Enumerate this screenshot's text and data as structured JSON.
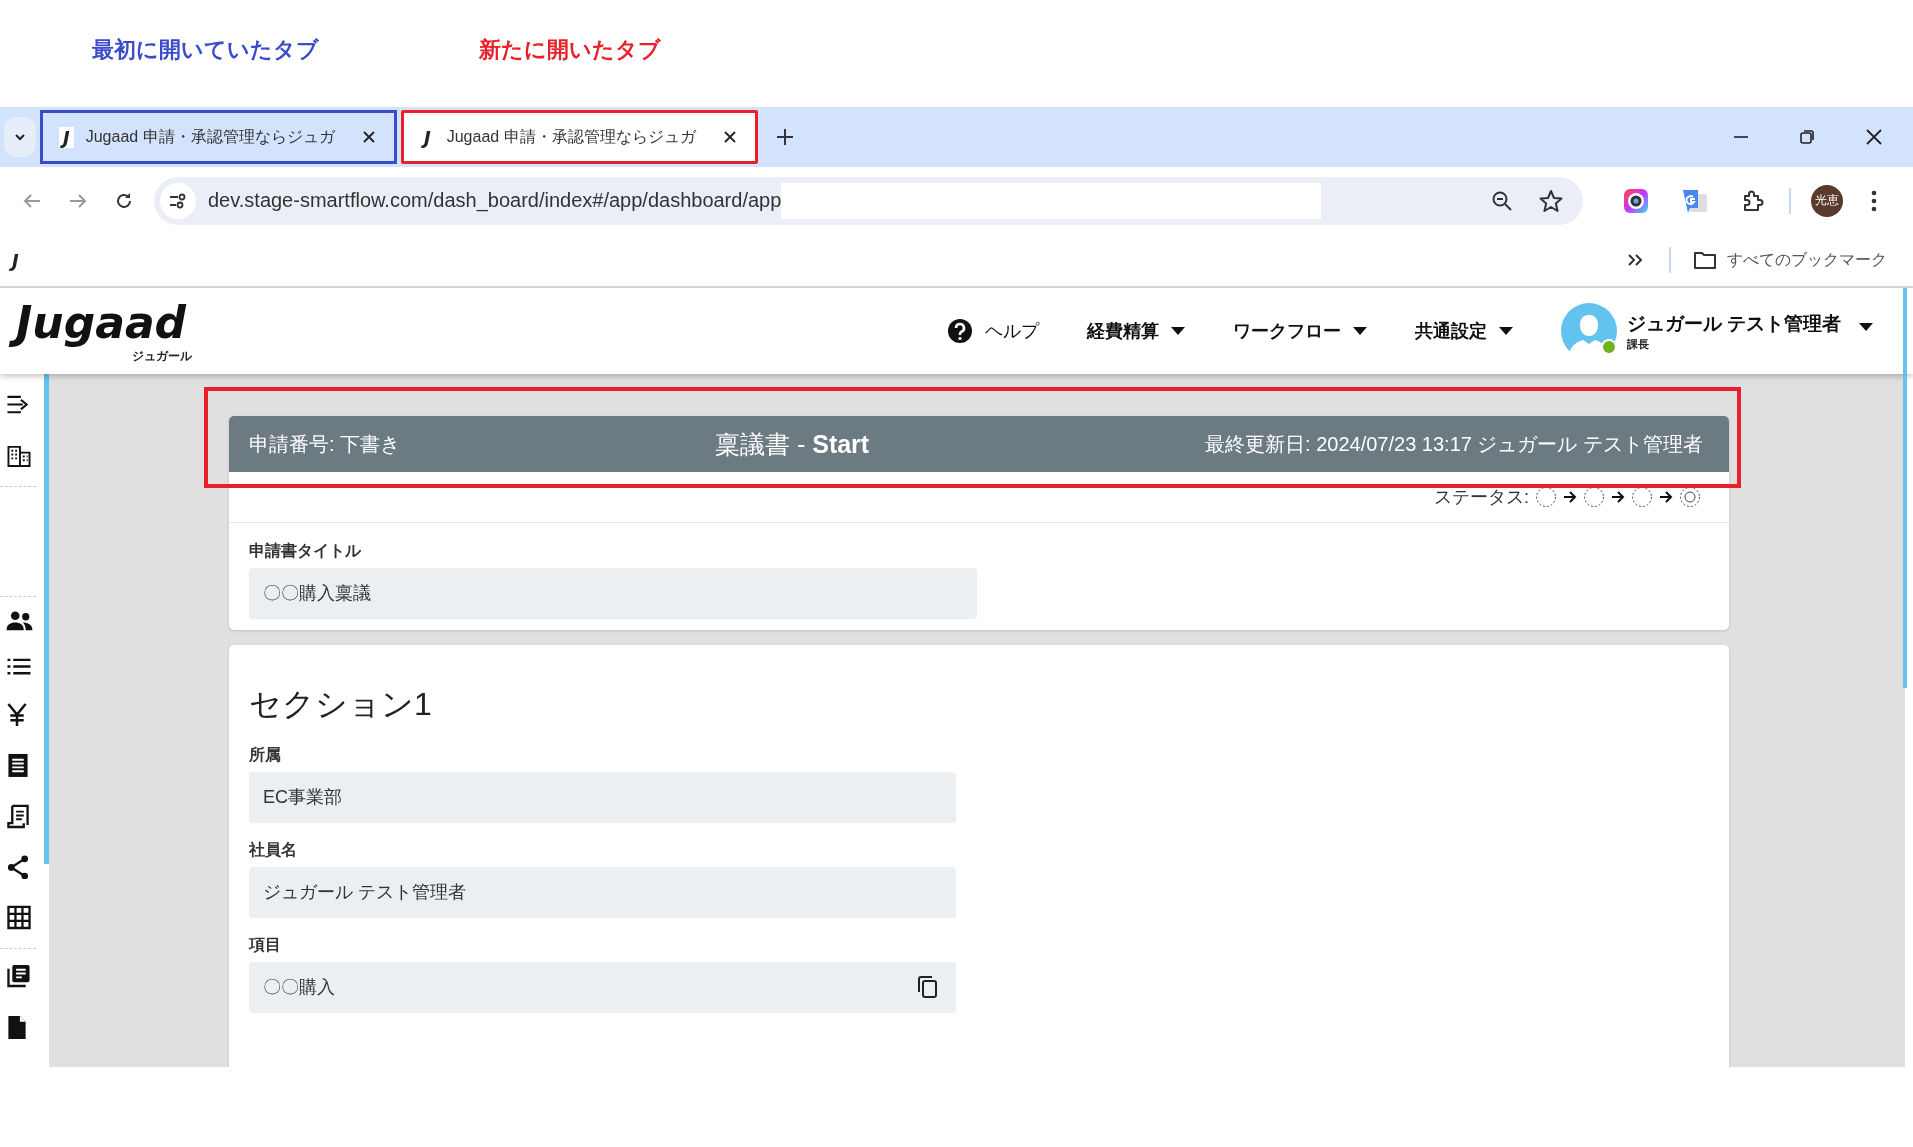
{
  "annotations": [
    {
      "text": "最初に開いていたタブ",
      "color": "#3b4cca"
    },
    {
      "text": "新たに開いたタブ",
      "color": "#e8202a"
    }
  ],
  "tabs": [
    {
      "favicon": "J",
      "title": "Jugaad 申請・承認管理ならジュガ",
      "selected": false,
      "color": "#3b4cca"
    },
    {
      "favicon": "J",
      "title": "Jugaad 申請・承認管理ならジュガ",
      "selected": true,
      "color": "#e8202a"
    }
  ],
  "address_bar": {
    "url": "dev.stage-smartflow.com/dash_board/index#/app/dashboard/app"
  },
  "profile": {
    "initials": "光恵"
  },
  "bookmarks_bar": {
    "bookmarks": [
      {
        "favicon": "J"
      }
    ],
    "all_bookmarks": "すべてのブックマーク"
  },
  "app": {
    "logo": {
      "wordmark": "Jugaad",
      "subtitle": "ジュガール"
    },
    "nav": [
      {
        "kind": "help",
        "label": "ヘルプ"
      },
      {
        "kind": "menu",
        "label": "経費精算"
      },
      {
        "kind": "menu",
        "label": "ワークフロー"
      },
      {
        "kind": "menu",
        "label": "共通設定"
      }
    ],
    "user": {
      "name": "ジュガール テスト管理者",
      "role": "課長",
      "online": true
    }
  },
  "form_header": {
    "number": "申請番号: 下書き",
    "title": "稟議書 - **Start**",
    "updated": "最終更新日: 2024/07/23 13:17  ジュガール テスト管理者",
    "color": "#e8202a"
  },
  "status": {
    "label": "ステータス:",
    "steps": [
      {
        "current": false
      },
      {
        "current": false
      },
      {
        "current": false
      },
      {
        "current": true
      }
    ]
  },
  "title_field": {
    "label": "申請書タイトル",
    "value": "〇〇購入稟議"
  },
  "section": {
    "heading": "セクション1",
    "fields": [
      {
        "label": "所属",
        "value": "EC事業部",
        "copyable": false
      },
      {
        "label": "社員名",
        "value": "ジュガール テスト管理者",
        "copyable": false
      },
      {
        "label": "項目",
        "value": "〇〇購入",
        "copyable": true
      }
    ]
  }
}
